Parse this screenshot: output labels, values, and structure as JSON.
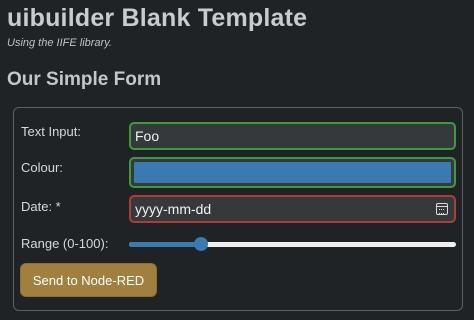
{
  "header": {
    "title": "uibuilder Blank Template",
    "subtitle": "Using the IIFE library."
  },
  "section": {
    "title": "Our Simple Form"
  },
  "form": {
    "text_input": {
      "label": "Text Input:",
      "value": "Foo"
    },
    "colour": {
      "label": "Colour:",
      "value": "#3a7ab0"
    },
    "date": {
      "label": "Date: *",
      "placeholder": "yyyy-mm-dd",
      "icon": "calendar-icon"
    },
    "range": {
      "label": "Range (0-100):",
      "min": 0,
      "max": 100,
      "value": 22
    },
    "send_button": {
      "label": "Send to Node-RED"
    }
  },
  "colors": {
    "background": "#1f2326",
    "valid_border": "#3f9a3f",
    "invalid_border": "#b23a3a",
    "button": "#a1803f",
    "accent": "#3a7ab0"
  }
}
